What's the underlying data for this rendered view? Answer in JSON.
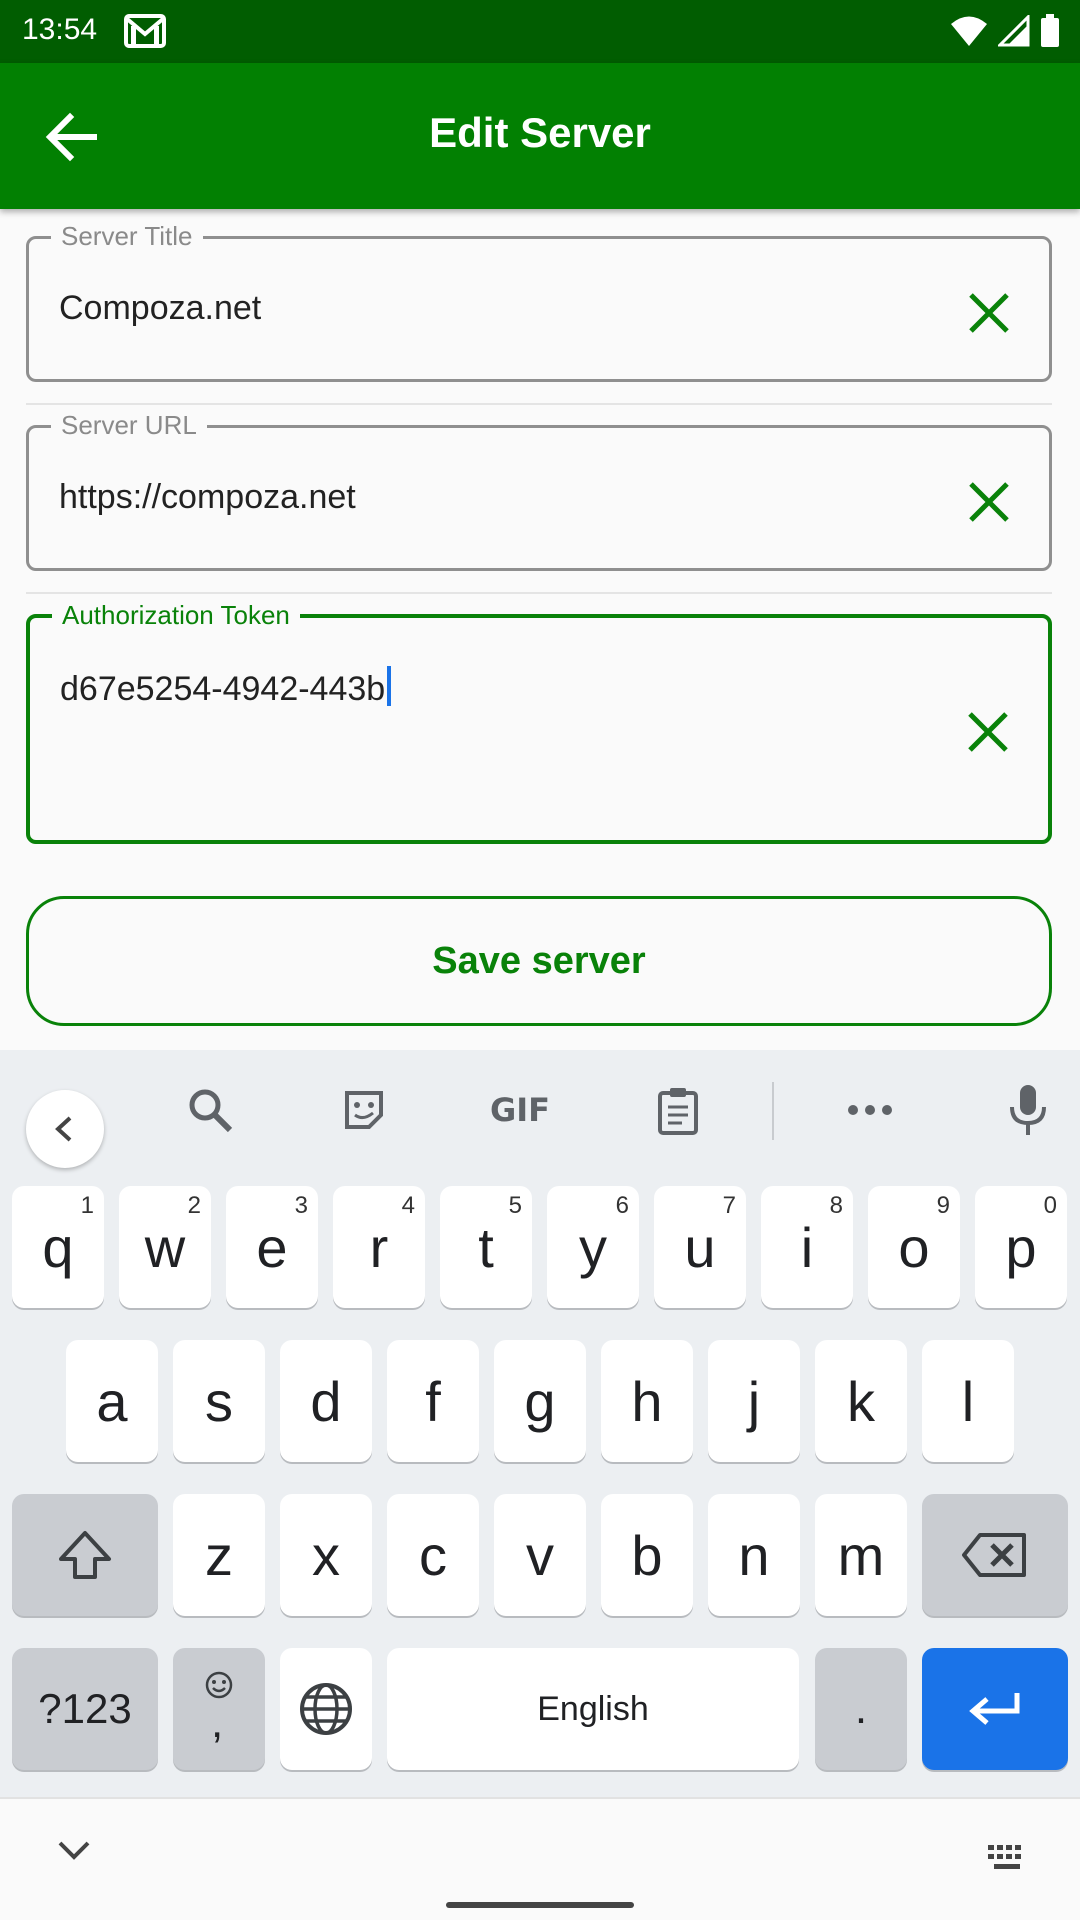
{
  "status_bar": {
    "time": "13:54"
  },
  "app_bar": {
    "title": "Edit Server"
  },
  "form": {
    "server_title": {
      "label": "Server Title",
      "value": "Compoza.net"
    },
    "server_url": {
      "label": "Server URL",
      "value": "https://compoza.net"
    },
    "auth_token": {
      "label": "Authorization Token",
      "value": "d67e5254-4942-443b"
    },
    "save_label": "Save server"
  },
  "keyboard": {
    "row1": [
      {
        "k": "q",
        "h": "1"
      },
      {
        "k": "w",
        "h": "2"
      },
      {
        "k": "e",
        "h": "3"
      },
      {
        "k": "r",
        "h": "4"
      },
      {
        "k": "t",
        "h": "5"
      },
      {
        "k": "y",
        "h": "6"
      },
      {
        "k": "u",
        "h": "7"
      },
      {
        "k": "i",
        "h": "8"
      },
      {
        "k": "o",
        "h": "9"
      },
      {
        "k": "p",
        "h": "0"
      }
    ],
    "row2": [
      "a",
      "s",
      "d",
      "f",
      "g",
      "h",
      "j",
      "k",
      "l"
    ],
    "row3": [
      "z",
      "x",
      "c",
      "v",
      "b",
      "n",
      "m"
    ],
    "symbols_label": "?123",
    "comma_label": ",",
    "space_label": "English",
    "period_label": ".",
    "gif_label": "GIF"
  },
  "colors": {
    "app_bar": "#028002",
    "status_bar": "#015d01",
    "accent": "#098209",
    "enter_key": "#1a73e8"
  }
}
